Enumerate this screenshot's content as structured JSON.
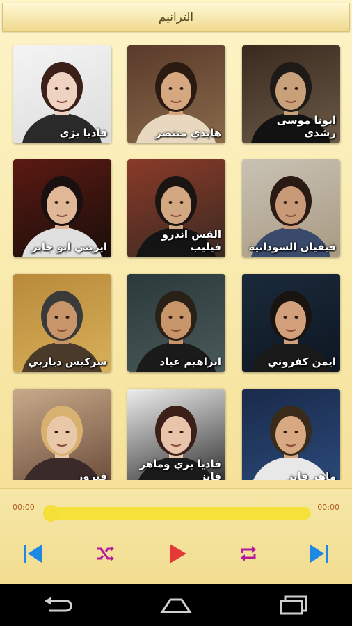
{
  "header": {
    "title": "الترانيم"
  },
  "tiles": [
    {
      "name": "ابونا موسى رشدى",
      "bg1": "#3a2a1e",
      "bg2": "#6b5a48",
      "skin": "#c8a07a",
      "hair": "#1e1a18",
      "cloth": "#121212"
    },
    {
      "name": "هايدي منتصر",
      "bg1": "#5a3a2a",
      "bg2": "#8a6a4a",
      "skin": "#d6a882",
      "hair": "#2a1a12",
      "cloth": "#e8d8c0"
    },
    {
      "name": "فاديا بزى",
      "bg1": "#f4f4f4",
      "bg2": "#dcdcdc",
      "skin": "#f0d2c0",
      "hair": "#3a2018",
      "cloth": "#2a2a2a"
    },
    {
      "name": "فيفيان السودانية",
      "bg1": "#c9c2b4",
      "bg2": "#a89a82",
      "skin": "#c89a78",
      "hair": "#2a1a14",
      "cloth": "#3a4a6a"
    },
    {
      "name": "القس اندرو فيليب",
      "bg1": "#8a3a28",
      "bg2": "#3a2a22",
      "skin": "#d2a882",
      "hair": "#1a1412",
      "cloth": "#141414"
    },
    {
      "name": "ايريني ابو جابر",
      "bg1": "#5a1a12",
      "bg2": "#1a0e0a",
      "skin": "#e0b898",
      "hair": "#1a1010",
      "cloth": "#e0e0e0"
    },
    {
      "name": "ايمن كفروني",
      "bg1": "#1a2a3a",
      "bg2": "#0e1622",
      "skin": "#d2a07a",
      "hair": "#1a1410",
      "cloth": "#1a1a1a"
    },
    {
      "name": "ابراهيم عياد",
      "bg1": "#2a3a3a",
      "bg2": "#4a5a5a",
      "skin": "#c8946a",
      "hair": "#2a2018",
      "cloth": "#1a1a1a"
    },
    {
      "name": "سركيس دياربي",
      "bg1": "#b88a3a",
      "bg2": "#d8b05a",
      "skin": "#c8946a",
      "hair": "#3a3a3a",
      "cloth": "#4a3a2a"
    },
    {
      "name": "ماهر فايز",
      "bg1": "#1a2a4a",
      "bg2": "#2a4a7a",
      "skin": "#d8a882",
      "hair": "#3a2a1a",
      "cloth": "#e8e8e8"
    },
    {
      "name": "فاديا بزي وماهر فايز",
      "bg1": "#eeeeee",
      "bg2": "#2a2a2a",
      "skin": "#e8c4aa",
      "hair": "#3a2018",
      "cloth": "#1a1a1a"
    },
    {
      "name": "فيروز",
      "bg1": "#c8aa8a",
      "bg2": "#6a4a3a",
      "skin": "#e8c8a8",
      "hair": "#d8b070",
      "cloth": "#3a2a2a"
    }
  ],
  "player": {
    "elapsed": "00:00",
    "duration": "00:00",
    "progress": 0
  },
  "colors": {
    "accent_blue": "#1e88e5",
    "accent_purple": "#b5179e",
    "accent_red": "#e53935",
    "seek_yellow": "#f6e23a"
  },
  "icons": {
    "prev": "skip-previous-icon",
    "shuffle": "shuffle-icon",
    "play": "play-icon",
    "repeat": "repeat-icon",
    "next": "skip-next-icon",
    "back": "back-icon",
    "home": "home-icon",
    "recents": "recent-apps-icon"
  }
}
